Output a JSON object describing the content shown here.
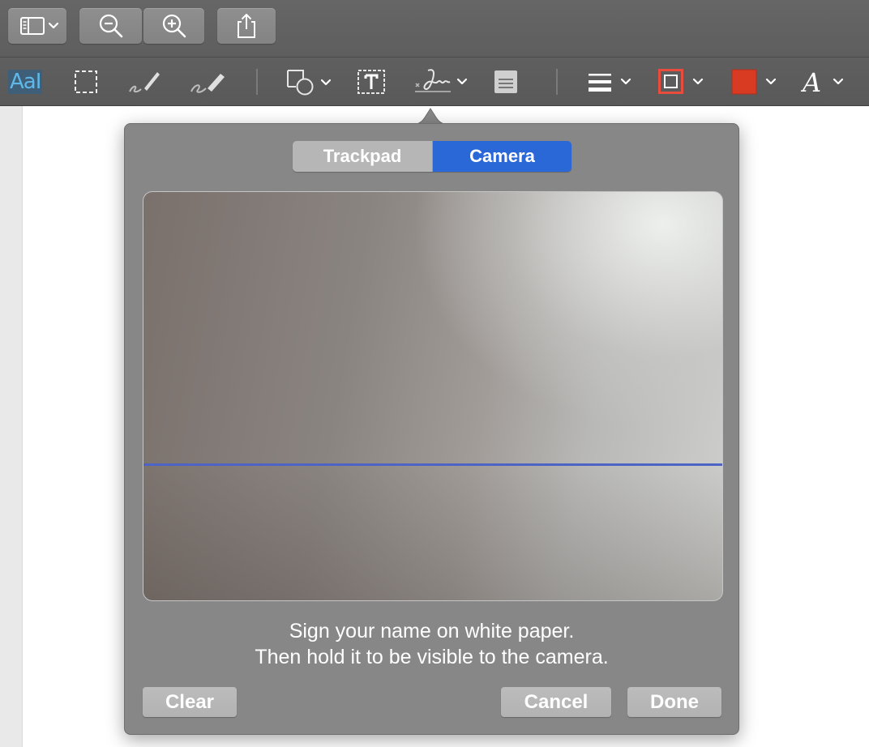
{
  "toolbar": {
    "icons": [
      "sidebar-icon",
      "chevron-down-icon",
      "zoom-out-icon",
      "zoom-in-icon",
      "share-icon"
    ]
  },
  "markup": {
    "text_tool_label": "AaI",
    "tools": [
      "text-selection-icon",
      "rectangular-selection-icon",
      "sketch-icon",
      "draw-icon",
      "shapes-icon",
      "text-box-icon",
      "sign-icon",
      "note-icon",
      "line-style-icon",
      "border-color-icon",
      "fill-color-icon",
      "text-style-icon"
    ],
    "fill_color": "#d83a22",
    "border_color": "#e74c3c",
    "accent_text_color": "#5fb8e8"
  },
  "signature_popover": {
    "tabs": [
      {
        "label": "Trackpad",
        "selected": false
      },
      {
        "label": "Camera",
        "selected": true
      }
    ],
    "instruction_line1": "Sign your name on white paper.",
    "instruction_line2": "Then hold it to be visible to the camera.",
    "clear_label": "Clear",
    "cancel_label": "Cancel",
    "done_label": "Done",
    "selected_color": "#2a67d7"
  }
}
